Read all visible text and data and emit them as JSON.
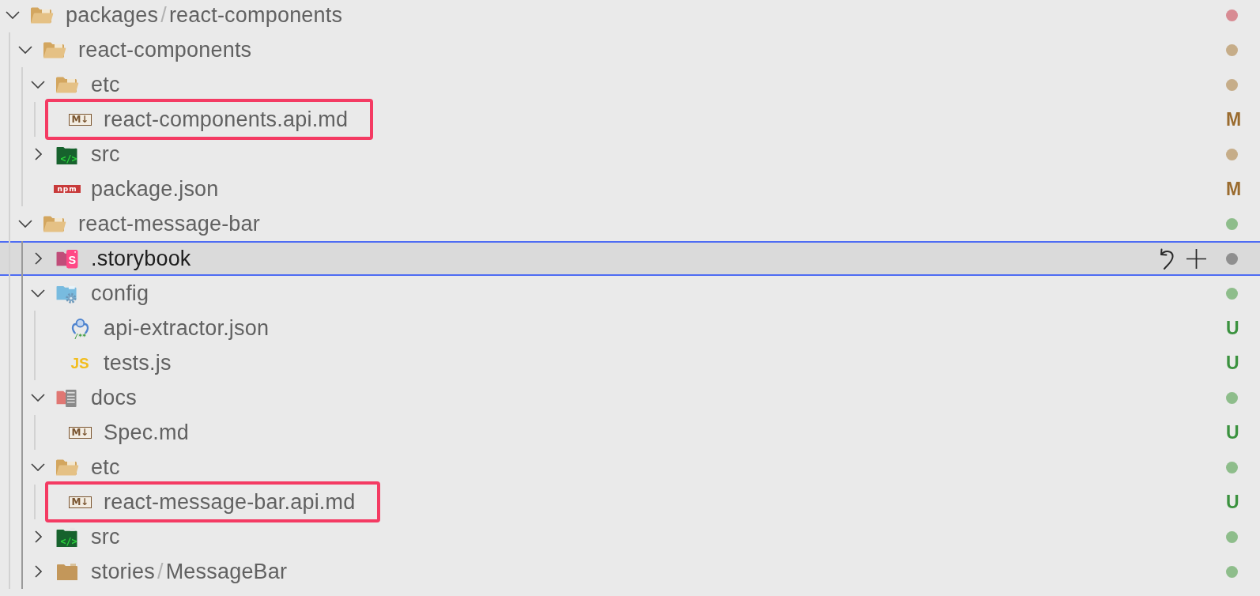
{
  "tree": [
    {
      "kind": "folder",
      "segments": [
        "packages",
        "react-components"
      ],
      "separator": "/",
      "expanded": true,
      "selected": false,
      "highlighted": false,
      "status": {
        "kind": "dot",
        "color": "#d88b93"
      },
      "children": [
        {
          "kind": "folder",
          "label": "react-components",
          "expanded": true,
          "selected": false,
          "highlighted": false,
          "status": {
            "kind": "dot",
            "color": "#c6ad89"
          },
          "children": [
            {
              "kind": "folder",
              "label": "etc",
              "expanded": true,
              "selected": false,
              "highlighted": false,
              "status": {
                "kind": "dot",
                "color": "#c6ad89"
              },
              "children": [
                {
                  "kind": "markdown",
                  "icon_text": "M↓",
                  "label": "react-components.api.md",
                  "selected": false,
                  "highlighted": true,
                  "status": {
                    "kind": "letter",
                    "text": "M",
                    "color": "#9a6b2e"
                  }
                }
              ]
            },
            {
              "kind": "codefolder",
              "icon_text": "</>",
              "label": "src",
              "expanded": false,
              "selected": false,
              "highlighted": false,
              "status": {
                "kind": "dot",
                "color": "#c6ad89"
              }
            },
            {
              "kind": "npm",
              "icon_text": "npm",
              "label": "package.json",
              "selected": false,
              "highlighted": false,
              "status": {
                "kind": "letter",
                "text": "M",
                "color": "#9a6b2e"
              }
            }
          ]
        },
        {
          "kind": "folder",
          "label": "react-message-bar",
          "expanded": true,
          "selected": false,
          "highlighted": false,
          "status": {
            "kind": "dot",
            "color": "#8ebd8b"
          },
          "children": [
            {
              "kind": "storybook",
              "icon_text": "S",
              "label": ".storybook",
              "expanded": false,
              "selected": true,
              "highlighted": false,
              "status": {
                "kind": "dot",
                "color": "#8f8f8f"
              }
            },
            {
              "kind": "configfolder",
              "label": "config",
              "expanded": true,
              "selected": false,
              "highlighted": false,
              "status": {
                "kind": "dot",
                "color": "#8ebd8b"
              },
              "children": [
                {
                  "kind": "extractor",
                  "icon_text": "/**",
                  "label": "api-extractor.json",
                  "selected": false,
                  "highlighted": false,
                  "status": {
                    "kind": "letter",
                    "text": "U",
                    "color": "#3b923f"
                  }
                },
                {
                  "kind": "script",
                  "icon_text": "JS",
                  "label": "tests.js",
                  "selected": false,
                  "highlighted": false,
                  "status": {
                    "kind": "letter",
                    "text": "U",
                    "color": "#3b923f"
                  }
                }
              ]
            },
            {
              "kind": "docsfolder",
              "label": "docs",
              "expanded": true,
              "selected": false,
              "highlighted": false,
              "status": {
                "kind": "dot",
                "color": "#8ebd8b"
              },
              "children": [
                {
                  "kind": "markdown",
                  "icon_text": "M↓",
                  "label": "Spec.md",
                  "selected": false,
                  "highlighted": false,
                  "status": {
                    "kind": "letter",
                    "text": "U",
                    "color": "#3b923f"
                  }
                }
              ]
            },
            {
              "kind": "folder",
              "label": "etc",
              "expanded": true,
              "selected": false,
              "highlighted": false,
              "status": {
                "kind": "dot",
                "color": "#8ebd8b"
              },
              "children": [
                {
                  "kind": "markdown",
                  "icon_text": "M↓",
                  "label": "react-message-bar.api.md",
                  "selected": false,
                  "highlighted": true,
                  "status": {
                    "kind": "letter",
                    "text": "U",
                    "color": "#3b923f"
                  }
                }
              ]
            },
            {
              "kind": "codefolder",
              "icon_text": "</>",
              "label": "src",
              "expanded": false,
              "selected": false,
              "highlighted": false,
              "status": {
                "kind": "dot",
                "color": "#8ebd8b"
              }
            },
            {
              "kind": "plainfolder",
              "segments": [
                "stories",
                "MessageBar"
              ],
              "separator": "/",
              "expanded": false,
              "selected": false,
              "highlighted": false,
              "status": {
                "kind": "dot",
                "color": "#8ebd8b"
              }
            }
          ]
        }
      ]
    }
  ]
}
